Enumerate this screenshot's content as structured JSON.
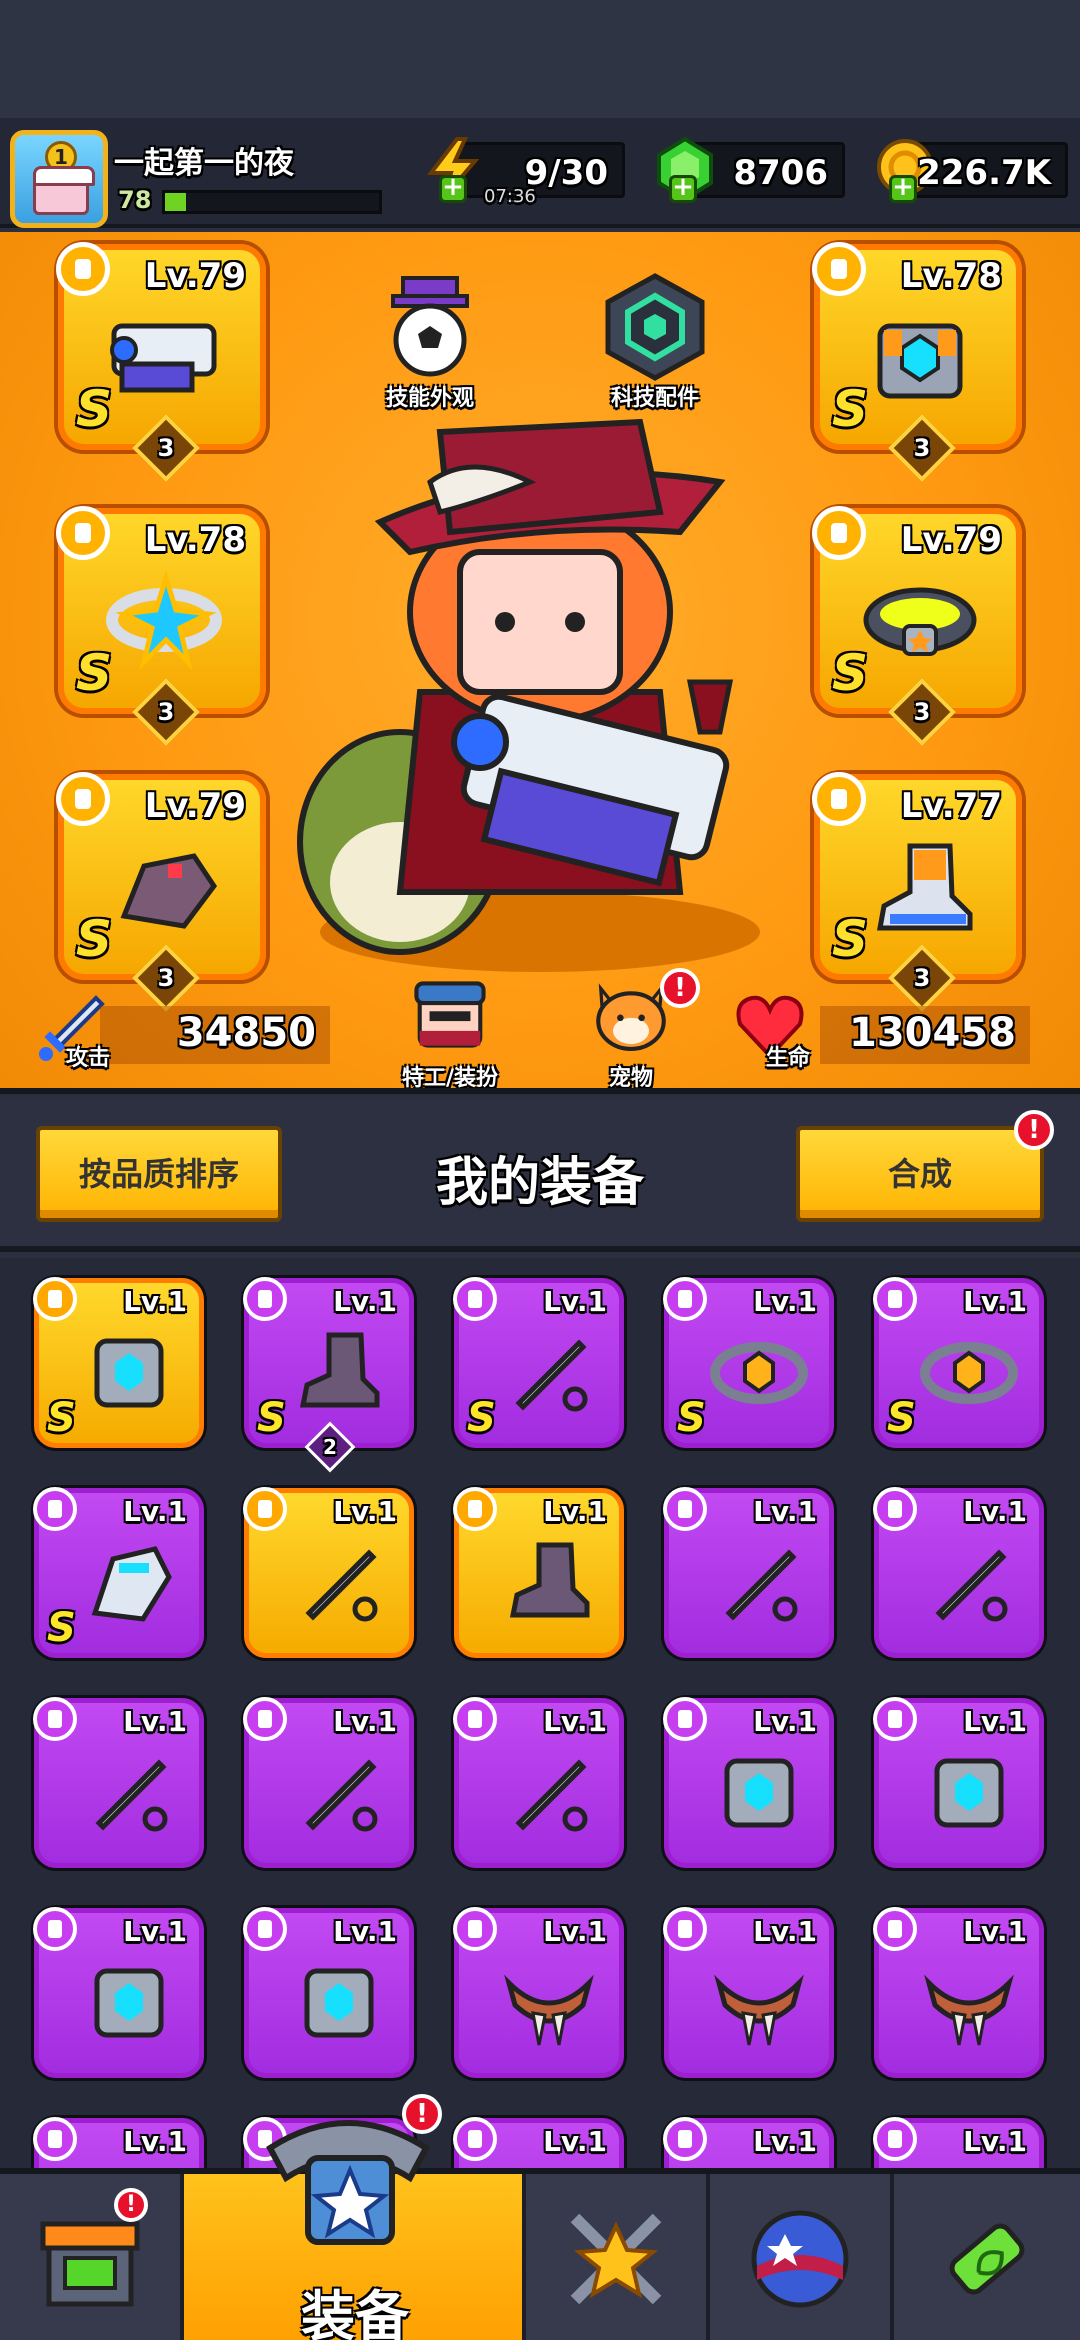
{
  "player": {
    "name": "一起第一的夜",
    "level": "78",
    "xp_fraction": 0.1,
    "avatar_rank": "1"
  },
  "resources": {
    "energy": "9/30",
    "energy_timer": "07:36",
    "gems": "8706",
    "coins": "226.7K"
  },
  "equipped": {
    "weapon": {
      "level": "Lv.79",
      "grade": "S",
      "stars": "3"
    },
    "ring": {
      "level": "Lv.78",
      "grade": "S",
      "stars": "3"
    },
    "glove": {
      "level": "Lv.79",
      "grade": "S",
      "stars": "3"
    },
    "armor": {
      "level": "Lv.78",
      "grade": "S",
      "stars": "3"
    },
    "belt": {
      "level": "Lv.79",
      "grade": "S",
      "stars": "3"
    },
    "boots": {
      "level": "Lv.77",
      "grade": "S",
      "stars": "3"
    }
  },
  "hero_buttons": {
    "skin": "技能外观",
    "tech": "科技配件",
    "agent": "特工/装扮",
    "pet": "宠物"
  },
  "stats": {
    "attack_label": "攻击",
    "attack": "34850",
    "hp_label": "生命",
    "hp": "130458"
  },
  "equip_bar": {
    "sort": "按品质排序",
    "title": "我的装备",
    "merge": "合成"
  },
  "alerts": {
    "mark": "!"
  },
  "inventory": [
    {
      "level": "Lv.1",
      "grade": "S",
      "rarity": "yellow",
      "kind": "armor"
    },
    {
      "level": "Lv.1",
      "grade": "S",
      "rarity": "purple",
      "kind": "boots",
      "count": "2"
    },
    {
      "level": "Lv.1",
      "grade": "S",
      "rarity": "purple",
      "kind": "weapon"
    },
    {
      "level": "Lv.1",
      "grade": "S",
      "rarity": "purple",
      "kind": "belt"
    },
    {
      "level": "Lv.1",
      "grade": "S",
      "rarity": "purple",
      "kind": "belt"
    },
    {
      "level": "Lv.1",
      "grade": "S",
      "rarity": "purple",
      "kind": "glove"
    },
    {
      "level": "Lv.1",
      "grade": "",
      "rarity": "yellow",
      "kind": "weapon"
    },
    {
      "level": "Lv.1",
      "grade": "",
      "rarity": "yellow",
      "kind": "boots"
    },
    {
      "level": "Lv.1",
      "grade": "",
      "rarity": "purple",
      "kind": "weapon"
    },
    {
      "level": "Lv.1",
      "grade": "",
      "rarity": "purple",
      "kind": "weapon"
    },
    {
      "level": "Lv.1",
      "grade": "",
      "rarity": "purple",
      "kind": "weapon"
    },
    {
      "level": "Lv.1",
      "grade": "",
      "rarity": "purple",
      "kind": "weapon"
    },
    {
      "level": "Lv.1",
      "grade": "",
      "rarity": "purple",
      "kind": "weapon"
    },
    {
      "level": "Lv.1",
      "grade": "",
      "rarity": "purple",
      "kind": "armor"
    },
    {
      "level": "Lv.1",
      "grade": "",
      "rarity": "purple",
      "kind": "armor"
    },
    {
      "level": "Lv.1",
      "grade": "",
      "rarity": "purple",
      "kind": "armor"
    },
    {
      "level": "Lv.1",
      "grade": "",
      "rarity": "purple",
      "kind": "armor"
    },
    {
      "level": "Lv.1",
      "grade": "",
      "rarity": "purple",
      "kind": "ring"
    },
    {
      "level": "Lv.1",
      "grade": "",
      "rarity": "purple",
      "kind": "ring"
    },
    {
      "level": "Lv.1",
      "grade": "",
      "rarity": "purple",
      "kind": "ring"
    },
    {
      "level": "Lv.1",
      "grade": "",
      "rarity": "purple",
      "kind": "ring"
    },
    {
      "level": "Lv.1",
      "grade": "",
      "rarity": "purple",
      "kind": "ring"
    },
    {
      "level": "Lv.1",
      "grade": "",
      "rarity": "purple",
      "kind": "ring"
    },
    {
      "level": "Lv.1",
      "grade": "",
      "rarity": "purple",
      "kind": "ring"
    },
    {
      "level": "Lv.1",
      "grade": "",
      "rarity": "purple",
      "kind": "ring"
    }
  ],
  "nav": {
    "shop": "shop-icon",
    "equip": "装备",
    "battle": "battle-icon",
    "dungeon": "dungeon-icon",
    "lab": "lab-icon"
  }
}
